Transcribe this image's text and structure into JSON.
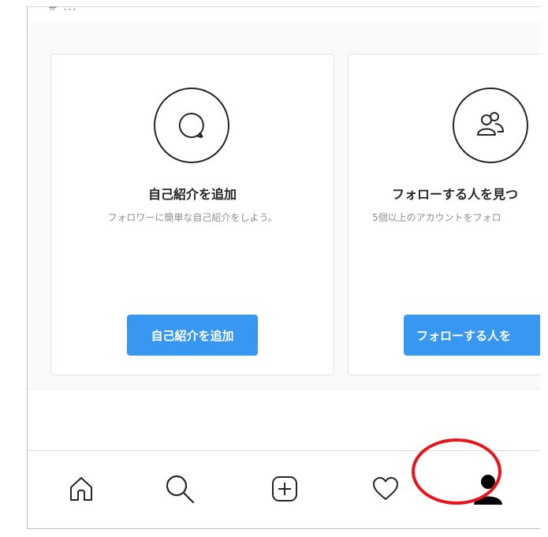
{
  "partial_top_text": "# ...",
  "cards": [
    {
      "icon": "speech-bubble-icon",
      "title": "自己紹介を追加",
      "subtitle": "フォロワーに簡単な自己紹介をしよう。",
      "button_label": "自己紹介を追加"
    },
    {
      "icon": "people-icon",
      "title": "フォローする人を見つ",
      "subtitle": "5個以上のアカウントをフォロ",
      "button_label": "フォローする人を"
    }
  ],
  "tabbar": {
    "items": [
      {
        "icon": "home-icon"
      },
      {
        "icon": "search-icon"
      },
      {
        "icon": "add-post-icon"
      },
      {
        "icon": "heart-icon"
      },
      {
        "icon": "profile-icon",
        "active": true
      }
    ]
  },
  "annotation": {
    "highlight_color": "#e8141c"
  },
  "colors": {
    "button_blue": "#3897f0",
    "text_dark": "#262626",
    "text_gray": "#8e8e8e"
  }
}
